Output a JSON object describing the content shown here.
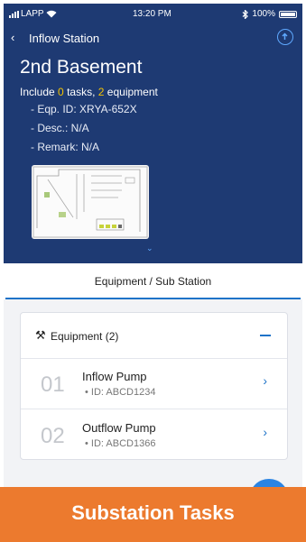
{
  "status_bar": {
    "carrier": "LAPP",
    "time": "13:20 PM",
    "battery": "100%"
  },
  "nav": {
    "back_icon": "chevron-left-icon",
    "title": "Inflow Station",
    "upload_icon": "upload-circle-icon"
  },
  "location": {
    "name": "2nd Basement",
    "summary_prefix": "Include",
    "task_count": "0",
    "tasks_label": "tasks,",
    "equipment_count": "2",
    "equipment_label": "equipment",
    "details": [
      "- Eqp. ID: XRYA-652X",
      "- Desc.: N/A",
      "- Remark: N/A"
    ]
  },
  "expand_icon": "chevron-down-icon",
  "tab": {
    "label": "Equipment / Sub Station"
  },
  "equipment_card": {
    "icon": "tools-icon",
    "title": "Equipment (2)",
    "collapse_icon": "minus-icon",
    "items": [
      {
        "index": "01",
        "name": "Inflow Pump",
        "id": "• ID: ABCD1234"
      },
      {
        "index": "02",
        "name": "Outflow Pump",
        "id": "• ID: ABCD1366"
      }
    ]
  },
  "banner": {
    "label": "Substation Tasks"
  },
  "colors": {
    "header": "#1e3a73",
    "accent": "#1e73c8",
    "highlight": "#f5c400",
    "banner": "#ec7a2e"
  }
}
